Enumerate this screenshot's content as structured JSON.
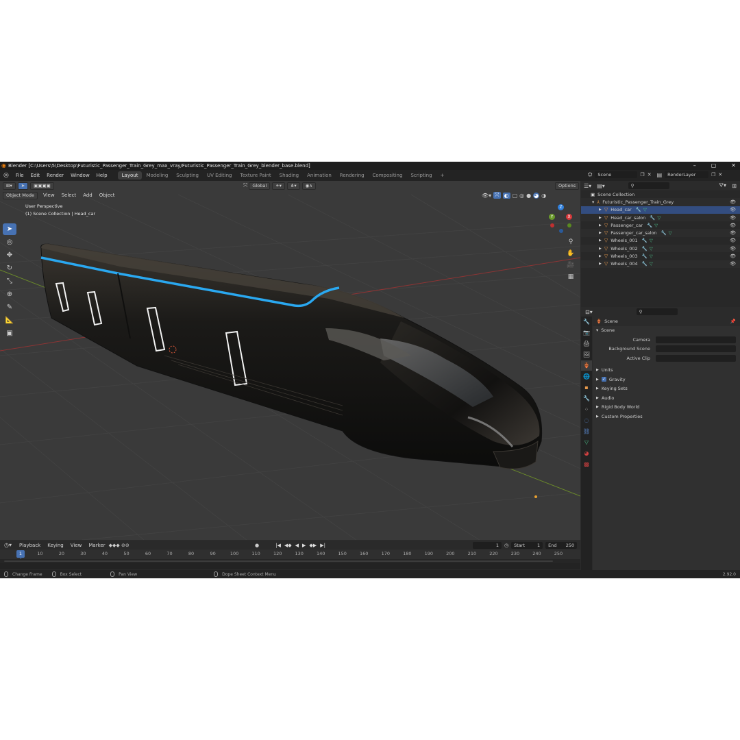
{
  "titlebar": {
    "text": "Blender [C:\\Users\\5\\Desktop\\Futuristic_Passenger_Train_Grey_max_vray/Futuristic_Passenger_Train_Grey_blender_base.blend]",
    "minimize": "–",
    "maximize": "▢",
    "close": "✕"
  },
  "menu": [
    "File",
    "Edit",
    "Render",
    "Window",
    "Help"
  ],
  "workspaces": [
    "Layout",
    "Modeling",
    "Sculpting",
    "UV Editing",
    "Texture Paint",
    "Shading",
    "Animation",
    "Rendering",
    "Compositing",
    "Scripting"
  ],
  "add_workspace": "+",
  "scene": {
    "name": "Scene",
    "render_layer": "RenderLayer"
  },
  "viewport": {
    "transform_orientation": "Global",
    "options_label": "Options",
    "mode": "Object Mode",
    "menus": [
      "View",
      "Select",
      "Add",
      "Object"
    ],
    "perspective": "User Perspective",
    "collection_info": "(1) Scene Collection | Head_car",
    "gizmo": {
      "x": "X",
      "y": "Y",
      "z": "Z"
    }
  },
  "timeline": {
    "menus": [
      "Playback",
      "Keying",
      "View",
      "Marker"
    ],
    "current_frame": "1",
    "start_label": "Start",
    "start": "1",
    "end_label": "End",
    "end": "250",
    "ticks": [
      "1",
      "10",
      "20",
      "30",
      "40",
      "50",
      "60",
      "70",
      "80",
      "90",
      "100",
      "110",
      "120",
      "130",
      "140",
      "150",
      "160",
      "170",
      "180",
      "190",
      "200",
      "210",
      "220",
      "230",
      "240",
      "250"
    ]
  },
  "statusbar": {
    "items": [
      "Change Frame",
      "Box Select",
      "Pan View",
      "Dope Sheet Context Menu"
    ],
    "version": "2.92.0"
  },
  "outliner": {
    "root": "Scene Collection",
    "collection": "Futuristic_Passenger_Train_Grey",
    "objects": [
      "Head_car",
      "Head_car_salon",
      "Passenger_car",
      "Passenger_car_salon",
      "Wheels_001",
      "Wheels_002",
      "Wheels_003",
      "Wheels_004"
    ]
  },
  "properties": {
    "context": "Scene",
    "panel": "Scene",
    "fields": [
      "Camera",
      "Background Scene",
      "Active Clip"
    ],
    "subpanels": [
      "Units",
      "Gravity",
      "Keying Sets",
      "Audio",
      "Rigid Body World",
      "Custom Properties"
    ],
    "gravity_checked": true
  },
  "colors": {
    "accent": "#4772b3",
    "stripe": "#2aa8f0",
    "grid_x": "#9a3a3a",
    "grid_y": "#6a8a2a"
  }
}
